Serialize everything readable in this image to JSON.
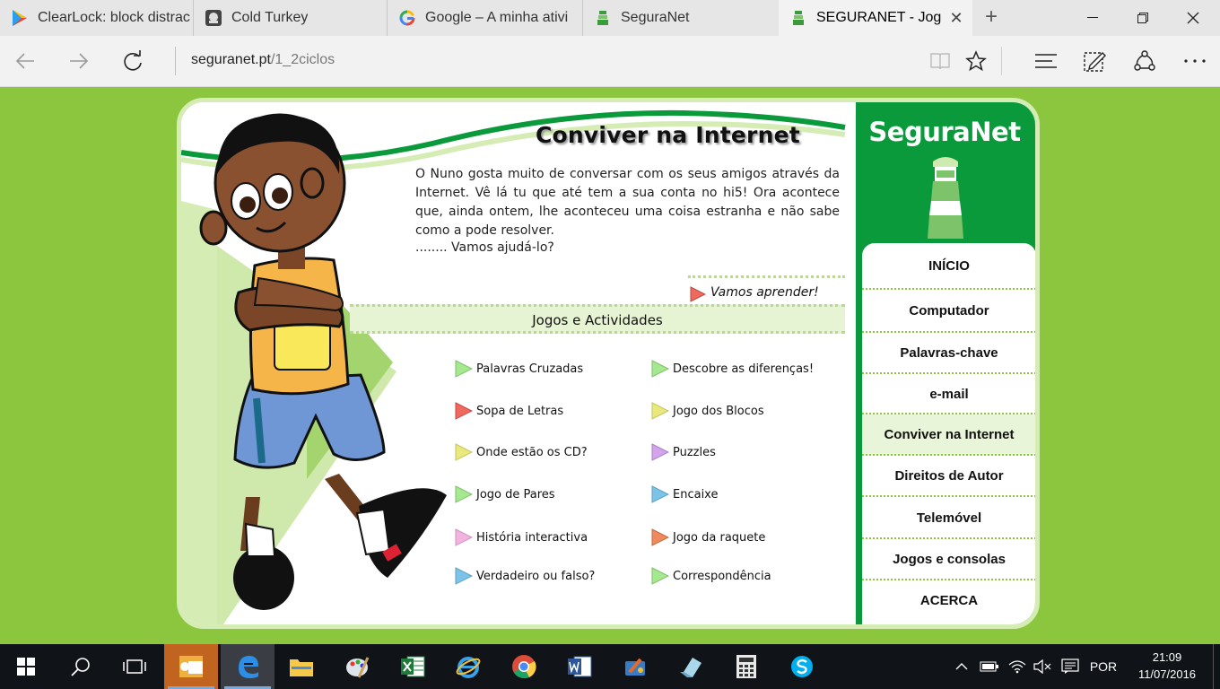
{
  "browser": {
    "tabs": [
      {
        "label": "ClearLock: block distrac",
        "icon": "play-store-icon"
      },
      {
        "label": "Cold Turkey",
        "icon": "cold-turkey-icon"
      },
      {
        "label": "Google – A minha ativi",
        "icon": "google-icon"
      },
      {
        "label": "SeguraNet",
        "icon": "seguranet-icon"
      },
      {
        "label": "SEGURANET - Jogo",
        "icon": "seguranet-icon",
        "active": true
      }
    ],
    "url_domain": "seguranet.pt",
    "url_path": "/1_2ciclos"
  },
  "page": {
    "title": "Conviver na Internet",
    "intro": "O Nuno gosta muito de conversar com os seus amigos através da Internet. Vê lá tu que até tem a sua conta no hi5! Ora acontece que, ainda ontem, lhe aconteceu uma coisa estranha e não sabe como a pode resolver.",
    "intro2": "........ Vamos ajudá-lo?",
    "learn_link": "Vamos aprender!",
    "games_heading": "Jogos e Actividades",
    "games_left": [
      {
        "label": "Palavras Cruzadas",
        "color": "#a6e88f"
      },
      {
        "label": "Sopa de Letras",
        "color": "#ee6a5e"
      },
      {
        "label": "Onde estão os CD?",
        "color": "#e8e87c"
      },
      {
        "label": "Jogo de Pares",
        "color": "#a6e88f"
      },
      {
        "label": "História interactiva",
        "color": "#f3b3e0"
      },
      {
        "label": "Verdadeiro ou falso?",
        "color": "#7cc3e8"
      }
    ],
    "games_right": [
      {
        "label": "Descobre as diferenças!",
        "color": "#a6e88f"
      },
      {
        "label": "Jogo dos Blocos",
        "color": "#e8e87c"
      },
      {
        "label": "Puzzles",
        "color": "#d3a4ec"
      },
      {
        "label": "Encaixe",
        "color": "#7cc3e8"
      },
      {
        "label": "Jogo da raquete",
        "color": "#ee8a5e"
      },
      {
        "label": "Correspondência",
        "color": "#a6e88f"
      }
    ]
  },
  "sidebar": {
    "logo": "SeguraNet",
    "menu": [
      {
        "label": "INÍCIO"
      },
      {
        "label": "Computador"
      },
      {
        "label": "Palavras-chave"
      },
      {
        "label": "e-mail"
      },
      {
        "label": "Conviver na Internet",
        "current": true
      },
      {
        "label": "Direitos de Autor"
      },
      {
        "label": "Telemóvel"
      },
      {
        "label": "Jogos e consolas"
      },
      {
        "label": "ACERCA"
      }
    ]
  },
  "taskbar": {
    "language": "POR",
    "time": "21:09",
    "date": "11/07/2016"
  },
  "colors": {
    "page_bg": "#8cc63f",
    "brand_green": "#0a9a3c",
    "light_green": "#d5ecb5"
  }
}
